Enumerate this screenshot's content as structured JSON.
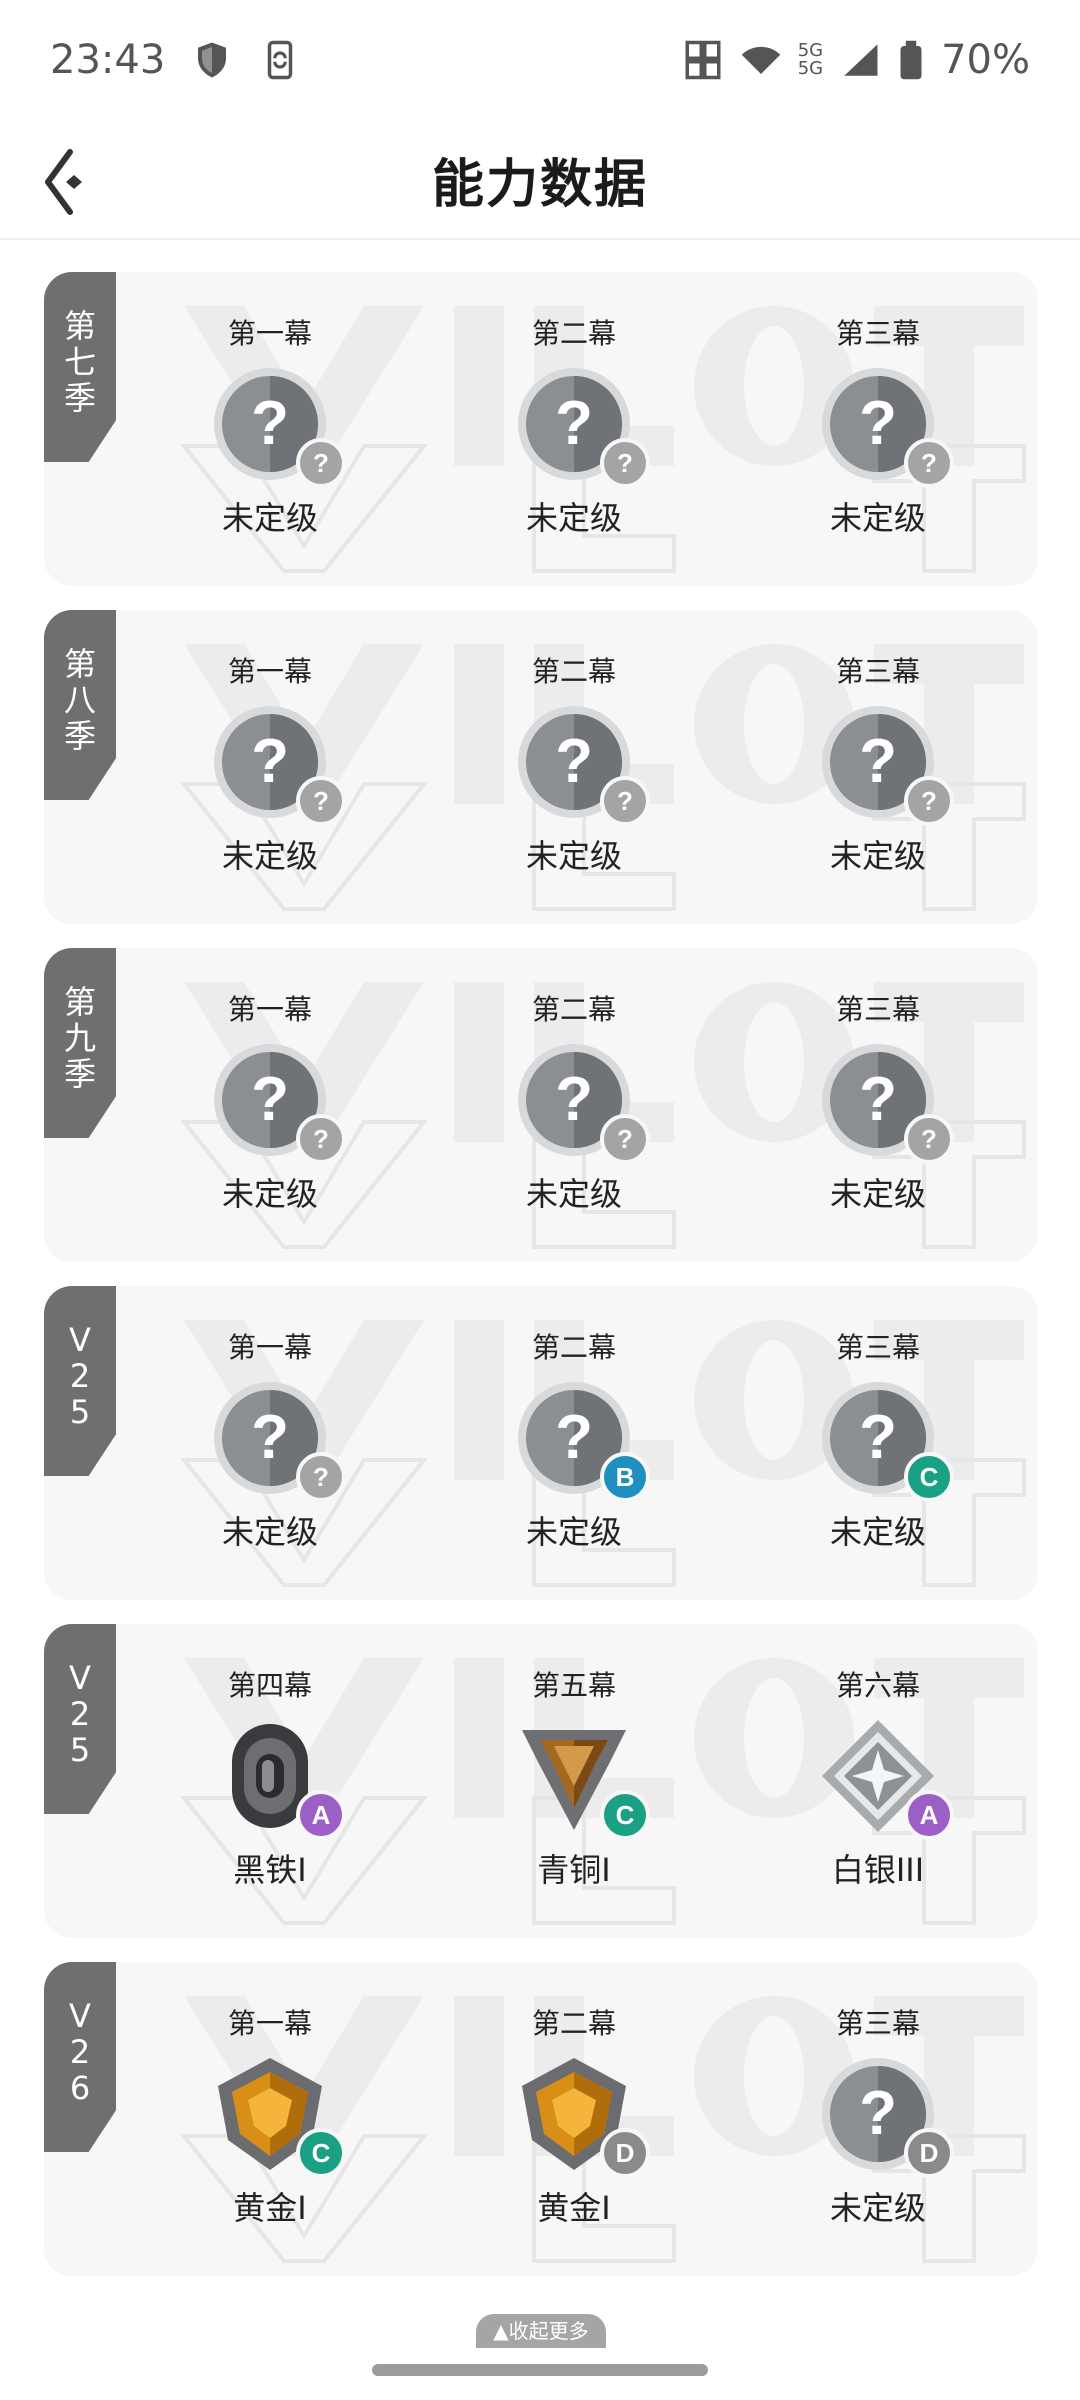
{
  "status": {
    "time": "23:43",
    "battery": "70%",
    "network_5g_top": "5G",
    "network_5g_bottom": "5G"
  },
  "header": {
    "title": "能力数据"
  },
  "seasons": [
    {
      "label": "第七季",
      "acts": [
        {
          "act": "第一幕",
          "rank": "未定级",
          "icon": "unranked-icon",
          "badge": "?"
        },
        {
          "act": "第二幕",
          "rank": "未定级",
          "icon": "unranked-icon",
          "badge": "?"
        },
        {
          "act": "第三幕",
          "rank": "未定级",
          "icon": "unranked-icon",
          "badge": "?"
        }
      ]
    },
    {
      "label": "第八季",
      "acts": [
        {
          "act": "第一幕",
          "rank": "未定级",
          "icon": "unranked-icon",
          "badge": "?"
        },
        {
          "act": "第二幕",
          "rank": "未定级",
          "icon": "unranked-icon",
          "badge": "?"
        },
        {
          "act": "第三幕",
          "rank": "未定级",
          "icon": "unranked-icon",
          "badge": "?"
        }
      ]
    },
    {
      "label": "第九季",
      "acts": [
        {
          "act": "第一幕",
          "rank": "未定级",
          "icon": "unranked-icon",
          "badge": "?"
        },
        {
          "act": "第二幕",
          "rank": "未定级",
          "icon": "unranked-icon",
          "badge": "?"
        },
        {
          "act": "第三幕",
          "rank": "未定级",
          "icon": "unranked-icon",
          "badge": "?"
        }
      ]
    },
    {
      "label": "V25",
      "acts": [
        {
          "act": "第一幕",
          "rank": "未定级",
          "icon": "unranked-icon",
          "badge": "?"
        },
        {
          "act": "第二幕",
          "rank": "未定级",
          "icon": "unranked-icon",
          "badge": "B"
        },
        {
          "act": "第三幕",
          "rank": "未定级",
          "icon": "unranked-icon",
          "badge": "C"
        }
      ]
    },
    {
      "label": "V25",
      "acts": [
        {
          "act": "第四幕",
          "rank": "黑铁I",
          "icon": "iron-rank-icon",
          "badge": "A"
        },
        {
          "act": "第五幕",
          "rank": "青铜I",
          "icon": "bronze-rank-icon",
          "badge": "C"
        },
        {
          "act": "第六幕",
          "rank": "白银III",
          "icon": "silver-rank-icon",
          "badge": "A"
        }
      ]
    },
    {
      "label": "V26",
      "acts": [
        {
          "act": "第一幕",
          "rank": "黄金I",
          "icon": "gold-rank-icon",
          "badge": "C"
        },
        {
          "act": "第二幕",
          "rank": "黄金I",
          "icon": "gold-rank-icon",
          "badge": "D"
        },
        {
          "act": "第三幕",
          "rank": "未定级",
          "icon": "unranked-icon",
          "badge": "D"
        }
      ]
    }
  ],
  "footer": {
    "collapse_label": "▲收起更多"
  },
  "colors": {
    "card_bg": "#f7f7f7",
    "tab_bg": "#6f6f6f",
    "badge_a": "#9b5fc6",
    "badge_b": "#1f8fc0",
    "badge_c": "#1aa085",
    "badge_d": "#8a8a8a"
  }
}
